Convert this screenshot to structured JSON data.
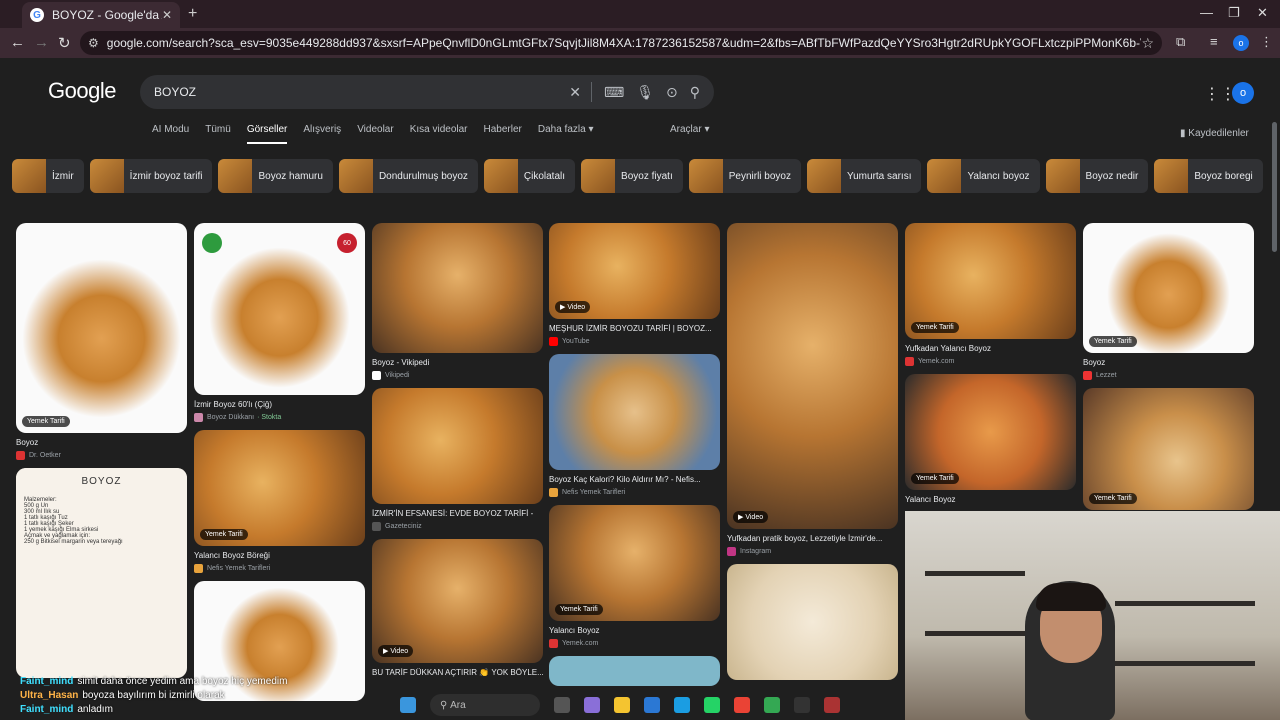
{
  "browser": {
    "tab_title": "BOYOZ - Google'da Ara",
    "tab_favicon": "G",
    "url": "google.com/search?sca_esv=9035e449288dd937&sxsrf=APpeQnvflD0nGLmtGFtx7SqvjtJil8M4XA:1787236152587&udm=2&fbs=ABfTbFWfPazdQeYYSro3Hgtr2dRUpkYGOFLxtczpiPPMonK6b-VUW62sVNClvOjXudyfFYR694_9bZqivV4Zt5kdHrm-x1QQ...",
    "profile_initial": "o"
  },
  "google": {
    "logo": "Google",
    "query": "BOYOZ",
    "avatar_initial": "o",
    "tabs": [
      "AI Modu",
      "Tümü",
      "Görseller",
      "Alışveriş",
      "Videolar",
      "Kısa videolar",
      "Haberler",
      "Daha fazla ▾"
    ],
    "tools": "Araçlar ▾",
    "saved": "Kaydedilenler"
  },
  "chips": [
    "İzmir",
    "İzmir boyoz tarifi",
    "Boyoz hamuru",
    "Dondurulmuş boyoz",
    "Çikolatalı",
    "Boyoz fiyatı",
    "Peynirli boyoz",
    "Yumurta sarısı",
    "Yalancı boyoz",
    "Boyoz nedir",
    "Boyoz boregi"
  ],
  "results": {
    "c1": [
      {
        "title": "Boyoz",
        "source": "Dr. Oetker",
        "badge": "Yemek Tarifi"
      },
      {
        "recipe_title": "BOYOZ",
        "recipe_lines": [
          "Malzemeler:",
          "500 g Un",
          "300 ml Ilık su",
          "1 tatlı kaşığı Tuz",
          "1 tatlı kaşığı Şeker",
          "1 yemek kaşığı Elma sirkesi",
          "Açmak ve yağlamak için:",
          "250 g Bitkisel margarin veya tereyağı"
        ]
      }
    ],
    "c2": [
      {
        "title": "İzmir Boyoz 60'lı (Çiğ)",
        "source": "Boyoz Dükkanı",
        "stock": "· Stokta",
        "count": "60"
      },
      {
        "title": "Yalancı Boyoz Böreği",
        "source": "Nefis Yemek Tarifleri",
        "badge": "Yemek Tarifi"
      }
    ],
    "c3": [
      {
        "title": "Boyoz - Vikipedi",
        "source": "Vikipedi"
      },
      {
        "title": "İZMİR'İN EFSANESİ: EVDE BOYOZ TARİFİ -",
        "source": "Gazeteciniz"
      },
      {
        "title": "BU TARİF DÜKKAN AÇTIRIR 👏 YOK BÖYLE...",
        "badge": "Video"
      }
    ],
    "c4": [
      {
        "title": "MEŞHUR İZMİR BOYOZU TARİFİ | BOYOZ...",
        "source": "YouTube",
        "badge": "Video"
      },
      {
        "title": "Boyoz Kaç Kalori? Kilo Aldırır Mı? - Nefis...",
        "source": "Nefis Yemek Tarifleri"
      },
      {
        "title": "Yalancı Boyoz",
        "source": "Yemek.com",
        "badge": "Yemek Tarifi"
      }
    ],
    "c5": [
      {
        "title": "Yufkadan pratik boyoz, Lezzetiyle İzmir'de...",
        "source": "Instagram",
        "badge": "Video"
      }
    ],
    "c6": [
      {
        "title": "Yufkadan Yalancı Boyoz",
        "source": "Yemek.com",
        "badge": "Yemek Tarifi"
      },
      {
        "title": "Yalancı Boyoz",
        "badge": "Yemek Tarifi"
      }
    ],
    "c7": [
      {
        "title": "Boyoz",
        "source": "Lezzet",
        "badge": "Yemek Tarifi"
      },
      {
        "badge": "Yemek Tarifi"
      }
    ]
  },
  "chat": [
    {
      "user": "Faint_mind",
      "msg": "simit daha önce yedim ama boyoz hiç yemedim"
    },
    {
      "user": "Ultra_Hasan",
      "msg": "boyoza bayılırım bi izmirli olarak"
    },
    {
      "user": "Faint_mind",
      "msg": "anladım"
    }
  ],
  "taskbar": {
    "search": "Ara"
  }
}
